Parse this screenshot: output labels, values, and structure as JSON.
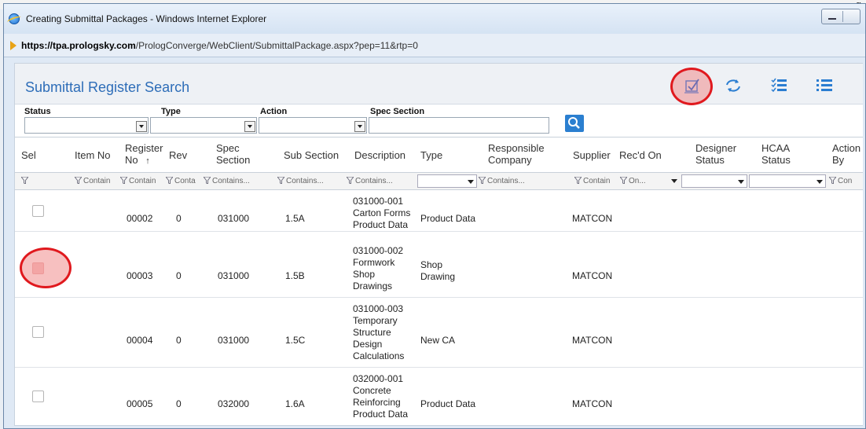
{
  "window": {
    "title": "Creating Submittal Packages - Windows Internet Explorer",
    "url_host": "https://tpa.prologsky.com",
    "url_path": "/PrologConverge/WebClient/SubmittalPackage.aspx?pep=11&rtp=0"
  },
  "background_window": {
    "tail_text": "g"
  },
  "panel": {
    "title": "Submittal Register Search"
  },
  "filters": {
    "status_label": "Status",
    "type_label": "Type",
    "action_label": "Action",
    "spec_section_label": "Spec Section",
    "spec_section_value": ""
  },
  "columns": {
    "sel": "Sel",
    "item_no": "Item No",
    "register_no_1": "Register",
    "register_no_2": "No",
    "sort_arrow": "↑",
    "rev": "Rev",
    "spec_1": "Spec",
    "spec_2": "Section",
    "sub_section": "Sub Section",
    "description": "Description",
    "type": "Type",
    "resp_1": "Responsible",
    "resp_2": "Company",
    "supplier": "Supplier",
    "recd_on": "Rec'd On",
    "designer_1": "Designer",
    "designer_2": "Status",
    "hcaa_1": "HCAA",
    "hcaa_2": "Status",
    "action_1": "Action",
    "action_2": "By"
  },
  "filter_row": {
    "item_no": "Contain",
    "register_no": "Contain",
    "rev": "Conta",
    "spec_section": "Contains...",
    "sub_section": "Contains...",
    "description": "Contains...",
    "responsible": "Contains...",
    "supplier": "Contain",
    "recd_on": "On...",
    "action_by": "Con"
  },
  "rows": [
    {
      "register_no": "00002",
      "rev": "0",
      "spec_section": "031000",
      "sub_section": "1.5A",
      "description": [
        "031000-001",
        "Carton Forms",
        "Product Data"
      ],
      "type": [
        "Product Data"
      ],
      "supplier": "MATCON"
    },
    {
      "register_no": "00003",
      "rev": "0",
      "spec_section": "031000",
      "sub_section": "1.5B",
      "description": [
        "031000-002",
        "Formwork",
        "Shop",
        "Drawings"
      ],
      "type": [
        "Shop",
        "Drawing"
      ],
      "supplier": "MATCON"
    },
    {
      "register_no": "00004",
      "rev": "0",
      "spec_section": "031000",
      "sub_section": "1.5C",
      "description": [
        "031000-003",
        "Temporary",
        "Structure",
        "Design",
        "Calculations"
      ],
      "type": [
        "New CA"
      ],
      "supplier": "MATCON"
    },
    {
      "register_no": "00005",
      "rev": "0",
      "spec_section": "032000",
      "sub_section": "1.6A",
      "description": [
        "032000-001",
        "Concrete",
        "Reinforcing",
        "Product Data"
      ],
      "type": [
        "Product Data"
      ],
      "supplier": "MATCON"
    }
  ],
  "colors": {
    "accent": "#2d6db8",
    "highlight": "#e0191e",
    "search_button": "#2b7fd0"
  },
  "icons": [
    "ie-logo-icon",
    "minimize-icon",
    "address-arrow-icon",
    "select-items-icon",
    "refresh-icon",
    "checklist-icon",
    "list-icon",
    "search-icon",
    "filter-icon",
    "dropdown-icon"
  ]
}
